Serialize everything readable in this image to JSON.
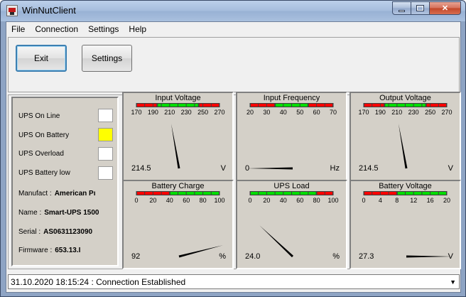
{
  "window": {
    "title": "WinNutClient"
  },
  "menu": {
    "items": [
      "File",
      "Connection",
      "Settings",
      "Help"
    ]
  },
  "toolbar": {
    "exit_label": "Exit",
    "settings_label": "Settings"
  },
  "status": {
    "indicators": [
      {
        "label": "UPS On Line",
        "active": false
      },
      {
        "label": "UPS On Battery",
        "active": true
      },
      {
        "label": "UPS Overload",
        "active": false
      },
      {
        "label": "UPS Battery low",
        "active": false
      }
    ],
    "active_color": "#ffff00",
    "info": [
      {
        "label": "Manufact :",
        "value": "American Pı"
      },
      {
        "label": "Name :",
        "value": "Smart-UPS 1500"
      },
      {
        "label": "Serial :",
        "value": "AS0631123090"
      },
      {
        "label": "Firmware :",
        "value": "653.13.I"
      }
    ]
  },
  "gauges": [
    {
      "title": "Input Voltage",
      "ticks": [
        "170",
        "190",
        "210",
        "230",
        "250",
        "270"
      ],
      "min": 170,
      "max": 270,
      "value": 214.5,
      "display": "214.5",
      "unit": "V",
      "zones": [
        [
          "#ff0000",
          170,
          195
        ],
        [
          "#00dd00",
          195,
          245
        ],
        [
          "#ff0000",
          245,
          270
        ]
      ]
    },
    {
      "title": "Input Frequency",
      "ticks": [
        "20",
        "30",
        "40",
        "50",
        "60",
        "70"
      ],
      "min": 20,
      "max": 70,
      "value": 0,
      "display": "0",
      "unit": "Hz",
      "zones": [
        [
          "#ff0000",
          20,
          35
        ],
        [
          "#00dd00",
          35,
          55
        ],
        [
          "#ff0000",
          55,
          70
        ]
      ]
    },
    {
      "title": "Output Voltage",
      "ticks": [
        "170",
        "190",
        "210",
        "230",
        "250",
        "270"
      ],
      "min": 170,
      "max": 270,
      "value": 214.5,
      "display": "214.5",
      "unit": "V",
      "zones": [
        [
          "#ff0000",
          170,
          195
        ],
        [
          "#00dd00",
          195,
          245
        ],
        [
          "#ff0000",
          245,
          270
        ]
      ]
    },
    {
      "title": "Battery Charge",
      "ticks": [
        "0",
        "20",
        "40",
        "60",
        "80",
        "100"
      ],
      "min": 0,
      "max": 100,
      "value": 92,
      "display": "92",
      "unit": "%",
      "zones": [
        [
          "#ff0000",
          0,
          40
        ],
        [
          "#00dd00",
          40,
          100
        ]
      ]
    },
    {
      "title": "UPS Load",
      "ticks": [
        "0",
        "20",
        "40",
        "60",
        "80",
        "100"
      ],
      "min": 0,
      "max": 100,
      "value": 24.0,
      "display": "24.0",
      "unit": "%",
      "zones": [
        [
          "#00dd00",
          0,
          80
        ],
        [
          "#ff0000",
          80,
          100
        ]
      ]
    },
    {
      "title": "Battery Voltage",
      "ticks": [
        "0",
        "4",
        "8",
        "12",
        "16",
        "20"
      ],
      "min": 0,
      "max": 20,
      "value": 27.3,
      "display": "27.3",
      "unit": "V",
      "zones": [
        [
          "#ff0000",
          0,
          8
        ],
        [
          "#00dd00",
          8,
          20
        ]
      ]
    }
  ],
  "statusbar": {
    "text": "31.10.2020 18:15:24 : Connection Established"
  }
}
